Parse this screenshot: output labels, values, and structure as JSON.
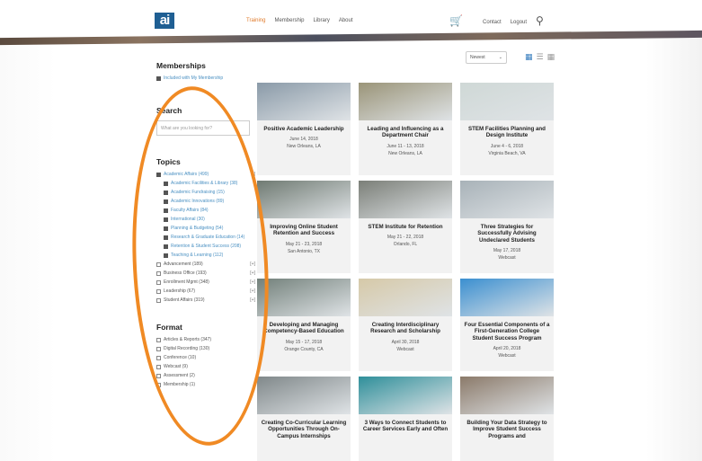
{
  "header": {
    "logo_text": "ai",
    "nav": [
      "Training",
      "Membership",
      "Library",
      "About"
    ],
    "active_nav": "Training",
    "cart_icon": "cart-icon",
    "links": [
      "Contact",
      "Logout"
    ],
    "search_icon": "search-icon"
  },
  "sidebar": {
    "memberships_title": "Memberships",
    "memberships_items": [
      {
        "label": "Included with My Membership",
        "checked": true
      }
    ],
    "search_title": "Search",
    "search_placeholder": "What are you looking for?",
    "topics_title": "Topics",
    "topics": [
      {
        "label": "Academic Affairs (499)",
        "toggle": "[-]",
        "checked": true,
        "sub": false
      },
      {
        "label": "Academic Facilities & Library (38)",
        "checked": true,
        "sub": true
      },
      {
        "label": "Academic Fundraising (15)",
        "checked": true,
        "sub": true
      },
      {
        "label": "Academic Innovations (89)",
        "checked": true,
        "sub": true
      },
      {
        "label": "Faculty Affairs (84)",
        "checked": true,
        "sub": true
      },
      {
        "label": "International (30)",
        "checked": true,
        "sub": true
      },
      {
        "label": "Planning & Budgeting (54)",
        "checked": true,
        "sub": true
      },
      {
        "label": "Research & Graduate Education (14)",
        "checked": true,
        "sub": true
      },
      {
        "label": "Retention & Student Success (208)",
        "checked": true,
        "sub": true
      },
      {
        "label": "Teaching & Learning (112)",
        "checked": true,
        "sub": true
      },
      {
        "label": "Advancement (189)",
        "toggle": "[+]",
        "checked": false,
        "sub": false
      },
      {
        "label": "Business Office (193)",
        "toggle": "[+]",
        "checked": false,
        "sub": false
      },
      {
        "label": "Enrollment Mgmt (348)",
        "toggle": "[+]",
        "checked": false,
        "sub": false
      },
      {
        "label": "Leadership (67)",
        "toggle": "[+]",
        "checked": false,
        "sub": false
      },
      {
        "label": "Student Affairs (319)",
        "toggle": "[+]",
        "checked": false,
        "sub": false
      }
    ],
    "format_title": "Format",
    "formats": [
      {
        "label": "Articles & Reports (347)",
        "checked": false
      },
      {
        "label": "Digital Recording (130)",
        "checked": false
      },
      {
        "label": "Conference (10)",
        "checked": false
      },
      {
        "label": "Webcast (9)",
        "checked": false
      },
      {
        "label": "Assessment (2)",
        "checked": false
      },
      {
        "label": "Membership (1)",
        "checked": false
      }
    ]
  },
  "toolbar": {
    "sort_value": "Newest",
    "view_icons": [
      "grid-view-icon",
      "list-view-icon",
      "calendar-view-icon"
    ]
  },
  "cards": [
    {
      "title": "Positive Academic Leadership",
      "date": "June 14, 2018",
      "location": "New Orleans, LA",
      "thumb": "#8a9aa8"
    },
    {
      "title": "Leading and Influencing as a Department Chair",
      "date": "June 11 - 13, 2018",
      "location": "New Orleans, LA",
      "thumb": "#9a9478"
    },
    {
      "title": "STEM Facilities Planning and Design Institute",
      "date": "June 4 - 6, 2018",
      "location": "Virginia Beach, VA",
      "thumb": "#cfd8d6"
    },
    {
      "title": "Improving Online Student Retention and Success",
      "date": "May 21 - 23, 2018",
      "location": "San Antonio, TX",
      "thumb": "#6f7a72"
    },
    {
      "title": "STEM Institute for Retention",
      "date": "May 21 - 22, 2018",
      "location": "Orlando, FL",
      "thumb": "#7b7f78"
    },
    {
      "title": "Three Strategies for Successfully Advising Undeclared Students",
      "date": "May 17, 2018",
      "location": "Webcast",
      "thumb": "#a8b2b8"
    },
    {
      "title": "Developing and Managing Competency-Based Education",
      "date": "May 15 - 17, 2018",
      "location": "Orange County, CA",
      "thumb": "#72807a"
    },
    {
      "title": "Creating Interdisciplinary Research and Scholarship",
      "date": "April 30, 2018",
      "location": "Webcast",
      "thumb": "#d6c9a8"
    },
    {
      "title": "Four Essential Components of a First-Generation College Student Success Program",
      "date": "April 20, 2018",
      "location": "Webcast",
      "thumb": "#3b8fd0"
    },
    {
      "title": "Creating Co-Curricular Learning Opportunities Through On-Campus Internships",
      "date": "",
      "location": "",
      "thumb": "#80888a"
    },
    {
      "title": "3 Ways to Connect Students to Career Services Early and Often",
      "date": "",
      "location": "",
      "thumb": "#2f8f9a"
    },
    {
      "title": "Building Your Data Strategy to Improve Student Success Programs and",
      "date": "",
      "location": "",
      "thumb": "#8b7a6a"
    }
  ],
  "colors": {
    "accent": "#e07a2a",
    "link": "#4a90c2",
    "oval": "#f08a24",
    "logo": "#1f5f93"
  }
}
